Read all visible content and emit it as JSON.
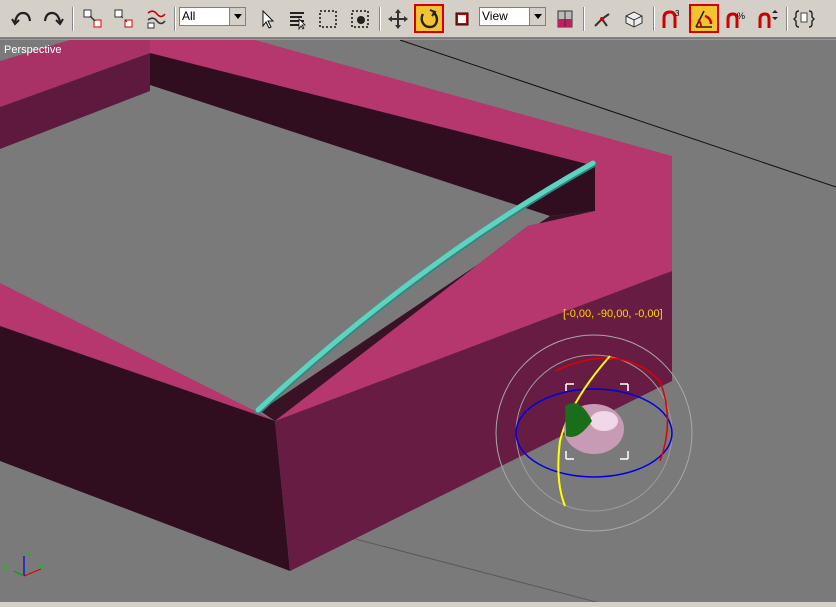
{
  "toolbar": {
    "selection_filter": "All",
    "reference_coordinate_system": "View",
    "tools": [
      {
        "name": "undo-icon"
      },
      {
        "name": "redo-icon"
      },
      {
        "name": "select-and-link-icon"
      },
      {
        "name": "unlink-selection-icon"
      },
      {
        "name": "bind-to-space-warp-icon"
      },
      {
        "name": "select-object-icon"
      },
      {
        "name": "select-by-name-icon"
      },
      {
        "name": "rectangular-selection-region-icon"
      },
      {
        "name": "window-crossing-icon"
      },
      {
        "name": "select-and-move-icon"
      },
      {
        "name": "select-and-rotate-icon",
        "active": true
      },
      {
        "name": "select-and-scale-icon"
      },
      {
        "name": "use-pivot-point-center-icon"
      },
      {
        "name": "select-and-manipulate-icon"
      },
      {
        "name": "keyboard-shortcut-override-icon"
      },
      {
        "name": "3d-snaps-toggle-icon"
      },
      {
        "name": "angle-snap-toggle-icon",
        "active": true
      },
      {
        "name": "percent-snap-toggle-icon"
      },
      {
        "name": "spinner-snap-toggle-icon"
      },
      {
        "name": "edit-named-selection-sets-icon"
      }
    ]
  },
  "viewport": {
    "label": "Perspective",
    "rotate_gizmo_readout": "[-0,00, -90,00, -0,00]",
    "axis_tripod": {
      "x": "x",
      "y": "y",
      "z": "z"
    }
  },
  "colors": {
    "box_top": "#b5376d",
    "box_side_dark": "#671c44",
    "box_inner": "#300e1f",
    "floor": "#7a7a7a",
    "tube": "#5fd3c0",
    "toolbar_bg": "#d4d0c8",
    "active_highlight": "#f4c430"
  }
}
